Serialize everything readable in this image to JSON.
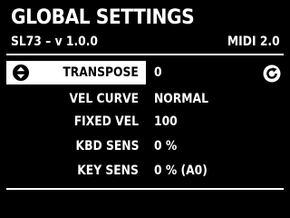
{
  "header": {
    "title": "GLOBAL SETTINGS",
    "device": "SL73 – v 1.0.0",
    "midi": "MIDI 2.0"
  },
  "settings": [
    {
      "label": "TRANSPOSE",
      "value": "0",
      "selected": true
    },
    {
      "label": "VEL CURVE",
      "value": "NORMAL",
      "selected": false
    },
    {
      "label": "FIXED VEL",
      "value": "100",
      "selected": false
    },
    {
      "label": "KBD SENS",
      "value": "0 %",
      "selected": false
    },
    {
      "label": "KEY SENS",
      "value": "0 % (A0)",
      "selected": false
    }
  ],
  "icons": {
    "selected_row_left": "up-down-arrows-icon",
    "selected_row_right": "reset-icon"
  },
  "colors": {
    "background": "#000000",
    "foreground": "#ffffff",
    "selection_fill": "#ffffff",
    "selection_text": "#000000"
  }
}
